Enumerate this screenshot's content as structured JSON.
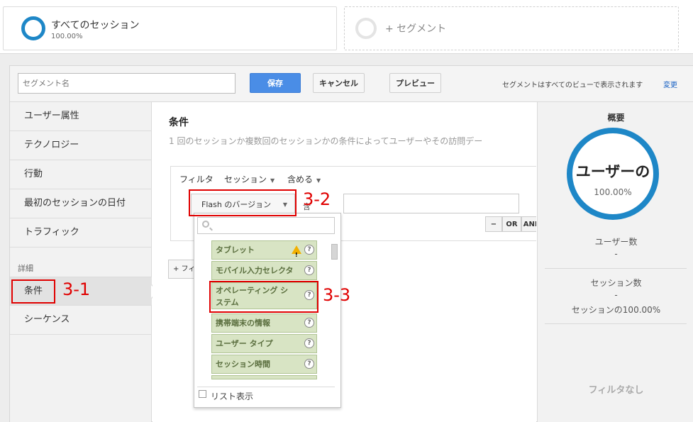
{
  "top": {
    "active_segment": {
      "name": "すべてのセッション",
      "percent": "100.00%"
    },
    "add_segment_label": "+ セグメント"
  },
  "header": {
    "name_placeholder": "セグメント名",
    "save_label": "保存",
    "cancel_label": "キャンセル",
    "preview_label": "プレビュー",
    "note": "セグメントはすべてのビューで表示されます",
    "change_link": "変更"
  },
  "nav": {
    "items": [
      {
        "label": "ユーザー属性"
      },
      {
        "label": "テクノロジー"
      },
      {
        "label": "行動"
      },
      {
        "label": "最初のセッションの日付"
      },
      {
        "label": "トラフィック"
      }
    ],
    "section_label": "詳細",
    "advanced_items": [
      {
        "label": "条件"
      },
      {
        "label": "シーケンス"
      }
    ]
  },
  "main": {
    "title": "条件",
    "description": "1 回のセッションか複数回のセッションかの条件によってユーザーやその訪問デー",
    "filter_label": "フィルタ",
    "scope_label": "セッション",
    "include_label": "含める",
    "dimension_label": "Flash のバージョン",
    "condition_label": "含",
    "logic_minus": "−",
    "logic_or": "OR",
    "logic_and": "AND",
    "add_filter_label": "+ フィ"
  },
  "popup": {
    "options": [
      {
        "label": "タブレット"
      },
      {
        "label": "モバイル入力セレクタ"
      },
      {
        "label": "オペレーティング シ",
        "label2": "ステム"
      },
      {
        "label": "携帯端末の情報"
      },
      {
        "label": "ユーザー タイプ"
      },
      {
        "label": "セッション時間"
      }
    ],
    "list_view_label": "リスト表示"
  },
  "summary": {
    "title": "概要",
    "ring_label": "ユーザーの",
    "ring_percent": "100.00%",
    "users_label": "ユーザー数",
    "users_value": "-",
    "sessions_label": "セッション数",
    "sessions_value": "-",
    "sessions_pct": "セッションの100.00%",
    "no_filter": "フィルタなし"
  },
  "annotations": {
    "a1": "3-1",
    "a2": "3-2",
    "a3": "3-3"
  },
  "colors": {
    "accent": "#1e87c7",
    "save_button": "#4a8de6",
    "annotation_red": "#e00000",
    "option_bg": "#d8e4c4"
  }
}
